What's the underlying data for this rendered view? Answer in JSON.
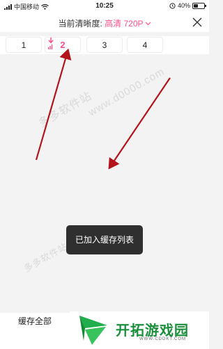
{
  "status_bar": {
    "carrier": "中国移动",
    "time": "10:25",
    "battery_text": "40%",
    "battery_level": 0.4
  },
  "header": {
    "label": "当前清晰度:",
    "quality": "高清 720P",
    "chevron_icon": "chevron-down-icon",
    "close_icon": "close-icon"
  },
  "episodes": {
    "items": [
      "1",
      "2",
      "3",
      "4"
    ],
    "active_index": 1,
    "downloading_icon": "download-icon"
  },
  "toast": {
    "text": "已加入缓存列表"
  },
  "watermarks": [
    "多多软件站",
    "www.d0000.com",
    "多多软件站"
  ],
  "bottom": {
    "cache_all": "缓存全部"
  },
  "site_logo": {
    "name": "开拓游戏园",
    "url": "WWW.CDDKT.COM"
  },
  "colors": {
    "accent": "#ff4f8b",
    "arrow": "#b3141c",
    "logo_green": "#1a8f3a"
  }
}
